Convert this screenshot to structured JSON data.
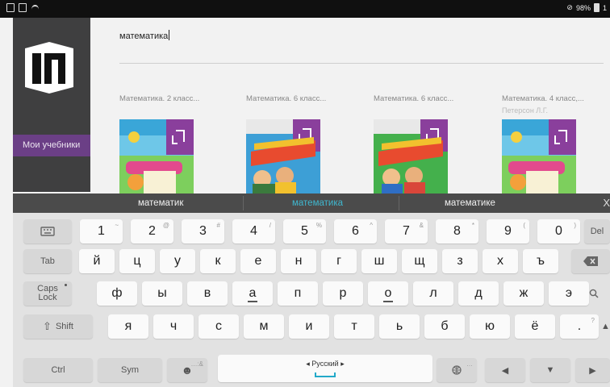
{
  "status_bar": {
    "battery": "98%",
    "time": "1"
  },
  "sidebar": {
    "menu_item": "Мои учебники"
  },
  "search": {
    "query": "математика"
  },
  "books": [
    {
      "title": "Математика. 2 класс...",
      "author": ""
    },
    {
      "title": "Математика. 6 класс...",
      "author": ""
    },
    {
      "title": "Математика. 6 класс...",
      "author": ""
    },
    {
      "title": "Математика. 4 класс,...",
      "author": "Петерсон Л.Г."
    }
  ],
  "suggestions": {
    "left": "математик",
    "center": "математика",
    "right": "математике",
    "close": "X"
  },
  "keyboard": {
    "row1": [
      "1",
      "2",
      "3",
      "4",
      "5",
      "6",
      "7",
      "8",
      "9",
      "0"
    ],
    "row1_sup": [
      "~",
      "@",
      "#",
      "/",
      "%",
      "^",
      "&",
      "*",
      "(",
      ")"
    ],
    "del": "Del",
    "row2": [
      "й",
      "ц",
      "у",
      "к",
      "е",
      "н",
      "г",
      "ш",
      "щ",
      "з",
      "х",
      "ъ"
    ],
    "tab": "Tab",
    "row3": [
      "ф",
      "ы",
      "в",
      "а",
      "п",
      "р",
      "о",
      "л",
      "д",
      "ж",
      "э"
    ],
    "caps_top": "Caps",
    "caps_bottom": "Lock",
    "row4": [
      "я",
      "ч",
      "с",
      "м",
      "и",
      "т",
      "ь",
      "б",
      "ю",
      "ё",
      "."
    ],
    "row4_last_sup": "?",
    "shift": "Shift",
    "ctrl": "Ctrl",
    "sym": "Sym",
    "language": "Русский",
    "emoji_sup": "…:&",
    "globe_sup": "…"
  },
  "colors": {
    "accent_purple": "#6b3f86",
    "suggestion_highlight": "#3fb7cf",
    "space_indicator": "#22a9c9"
  }
}
